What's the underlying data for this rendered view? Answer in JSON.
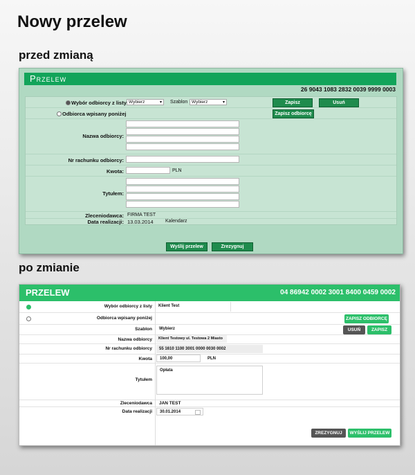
{
  "page_title": "Nowy przelew",
  "before_heading": "przed zmianą",
  "after_heading": "po zmianie",
  "old": {
    "title": "Przelew",
    "account_number": "26 9043 1083 2832 0039 9999 0003",
    "radio_list_label": "Wybór odbiorcy z listy",
    "select_recipient": "Wybierz",
    "template_label": "Szablon",
    "select_template": "Wybierz",
    "save_btn": "Zapisz",
    "delete_btn": "Usuń",
    "radio_manual_label": "Odbiorca wpisany poniżej",
    "save_recipient_btn": "Zapisz odbiorcę",
    "recipient_name_label": "Nazwa odbiorcy:",
    "account_label": "Nr rachunku odbiorcy:",
    "amount_label": "Kwota:",
    "currency": "PLN",
    "title_label": "Tytułem:",
    "orderer_label": "Zleceniodawca:",
    "orderer_value": "FIRMA TEST",
    "date_label": "Data realizacji:",
    "date_value": "13.03.2014",
    "calendar_label": "Kalendarz",
    "send_btn": "Wyślij przelew",
    "cancel_btn": "Zrezygnuj"
  },
  "new": {
    "title": "PRZELEW",
    "account_number": "04 86942 0002 3001 8400 0459 0002",
    "radio_list_label": "Wybór odbiorcy z listy",
    "recipient_select_value": "Klient Test",
    "radio_manual_label": "Odbiorca wpisany poniżej",
    "save_recipient_btn": "ZAPISZ ODBIORCĘ",
    "template_label": "Szablon",
    "template_value": "Wybierz",
    "delete_btn": "USUŃ",
    "save_btn": "ZAPISZ",
    "recipient_name_label": "Nazwa odbiorcy",
    "recipient_name_value": "Klient Testowy ul. Testowa 2 Miasto",
    "account_label": "Nr rachunku odbiorcy",
    "account_value": "55 1610 1100 3001 0000 0030 0002",
    "amount_label": "Kwota",
    "amount_value": "100,00",
    "currency": "PLN",
    "title_label": "Tytułem",
    "title_value": "Opłata",
    "orderer_label": "Zleceniodawca",
    "orderer_value": "JAN TEST",
    "date_label": "Data realizacji",
    "date_value": "30.01.2014",
    "cancel_btn": "ZREZYGNUJ",
    "send_btn": "WYŚLIJ PRZELEW"
  }
}
